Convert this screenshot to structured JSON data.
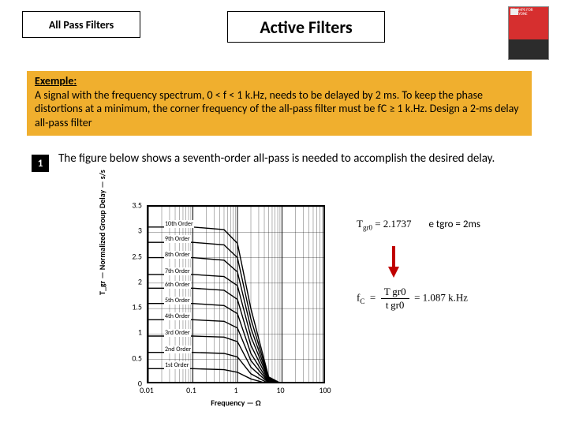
{
  "header": {
    "subtitle": "All Pass Filters",
    "title": "Active Filters",
    "book_caption": "OP AMPS FOR EVERYONE"
  },
  "example": {
    "label": "Exemple:",
    "text": "A signal with the frequency spectrum, 0 < f < 1 k.Hz, needs to be delayed by 2 ms. To keep the phase distortions at a minimum, the corner frequency of the all-pass filter must be fC ≥ 1 k.Hz. Design a 2-ms delay all-pass filter"
  },
  "step": {
    "num": "1",
    "text": "The figure below shows a seventh-order all-pass is needed to accomplish the desired delay."
  },
  "equations": {
    "tgr0_lhs": "T",
    "tgr0_sub": "gr0",
    "tgr0_rhs": "= 2.1737",
    "note": "e tgro = 2ms",
    "fc_lhs": "f",
    "fc_sub": "C",
    "fc_frac_num": "T gr0",
    "fc_frac_den": "t gr0",
    "fc_rhs": "= 1.087 k.Hz"
  },
  "chart_data": {
    "type": "line",
    "title": "",
    "xlabel": "Frequency — Ω",
    "ylabel": "T_gr — Normalized Group Delay — s/s",
    "x_scale": "log",
    "xlim": [
      0.01,
      100
    ],
    "ylim": [
      0,
      3.5
    ],
    "x_ticks": [
      0.01,
      0.1,
      1,
      10,
      100
    ],
    "y_ticks": [
      0,
      0.5,
      1,
      1.5,
      2,
      2.5,
      3,
      3.5
    ],
    "order_labels": [
      "1st Order",
      "2nd Order",
      "3rd Order",
      "4th Order",
      "5th Order",
      "6th Order",
      "7th Order",
      "8th Order",
      "9th Order",
      "10th Order"
    ],
    "series": [
      {
        "name": "1st Order",
        "x": [
          0.01,
          0.1,
          0.5,
          1,
          2,
          5,
          10,
          100
        ],
        "y": [
          0.32,
          0.32,
          0.3,
          0.25,
          0.12,
          0.02,
          0.0,
          0.0
        ]
      },
      {
        "name": "2nd Order",
        "x": [
          0.01,
          0.1,
          0.5,
          1,
          2,
          5,
          10,
          100
        ],
        "y": [
          0.64,
          0.64,
          0.62,
          0.55,
          0.22,
          0.03,
          0.0,
          0.0
        ]
      },
      {
        "name": "3rd Order",
        "x": [
          0.01,
          0.1,
          0.5,
          1,
          2,
          5,
          10,
          100
        ],
        "y": [
          0.96,
          0.96,
          0.94,
          0.85,
          0.35,
          0.04,
          0.0,
          0.0
        ]
      },
      {
        "name": "4th Order",
        "x": [
          0.01,
          0.1,
          0.5,
          1,
          2,
          5,
          10,
          100
        ],
        "y": [
          1.28,
          1.28,
          1.25,
          1.12,
          0.48,
          0.05,
          0.01,
          0.0
        ]
      },
      {
        "name": "5th Order",
        "x": [
          0.01,
          0.1,
          0.5,
          1,
          2,
          5,
          10,
          100
        ],
        "y": [
          1.6,
          1.6,
          1.56,
          1.4,
          0.62,
          0.06,
          0.01,
          0.0
        ]
      },
      {
        "name": "6th Order",
        "x": [
          0.01,
          0.1,
          0.5,
          1,
          2,
          5,
          10,
          100
        ],
        "y": [
          1.9,
          1.9,
          1.86,
          1.68,
          0.78,
          0.08,
          0.01,
          0.0
        ]
      },
      {
        "name": "7th Order",
        "x": [
          0.01,
          0.1,
          0.5,
          1,
          2,
          5,
          10,
          100
        ],
        "y": [
          2.17,
          2.17,
          2.13,
          1.95,
          0.95,
          0.1,
          0.01,
          0.0
        ]
      },
      {
        "name": "8th Order",
        "x": [
          0.01,
          0.1,
          0.5,
          1,
          2,
          5,
          10,
          100
        ],
        "y": [
          2.5,
          2.5,
          2.45,
          2.22,
          1.12,
          0.12,
          0.01,
          0.0
        ]
      },
      {
        "name": "9th Order",
        "x": [
          0.01,
          0.1,
          0.5,
          1,
          2,
          5,
          10,
          100
        ],
        "y": [
          2.8,
          2.8,
          2.75,
          2.5,
          1.3,
          0.14,
          0.02,
          0.0
        ]
      },
      {
        "name": "10th Order",
        "x": [
          0.01,
          0.1,
          0.5,
          1,
          2,
          5,
          10,
          100
        ],
        "y": [
          3.1,
          3.1,
          3.05,
          2.78,
          1.5,
          0.16,
          0.02,
          0.0
        ]
      }
    ]
  }
}
